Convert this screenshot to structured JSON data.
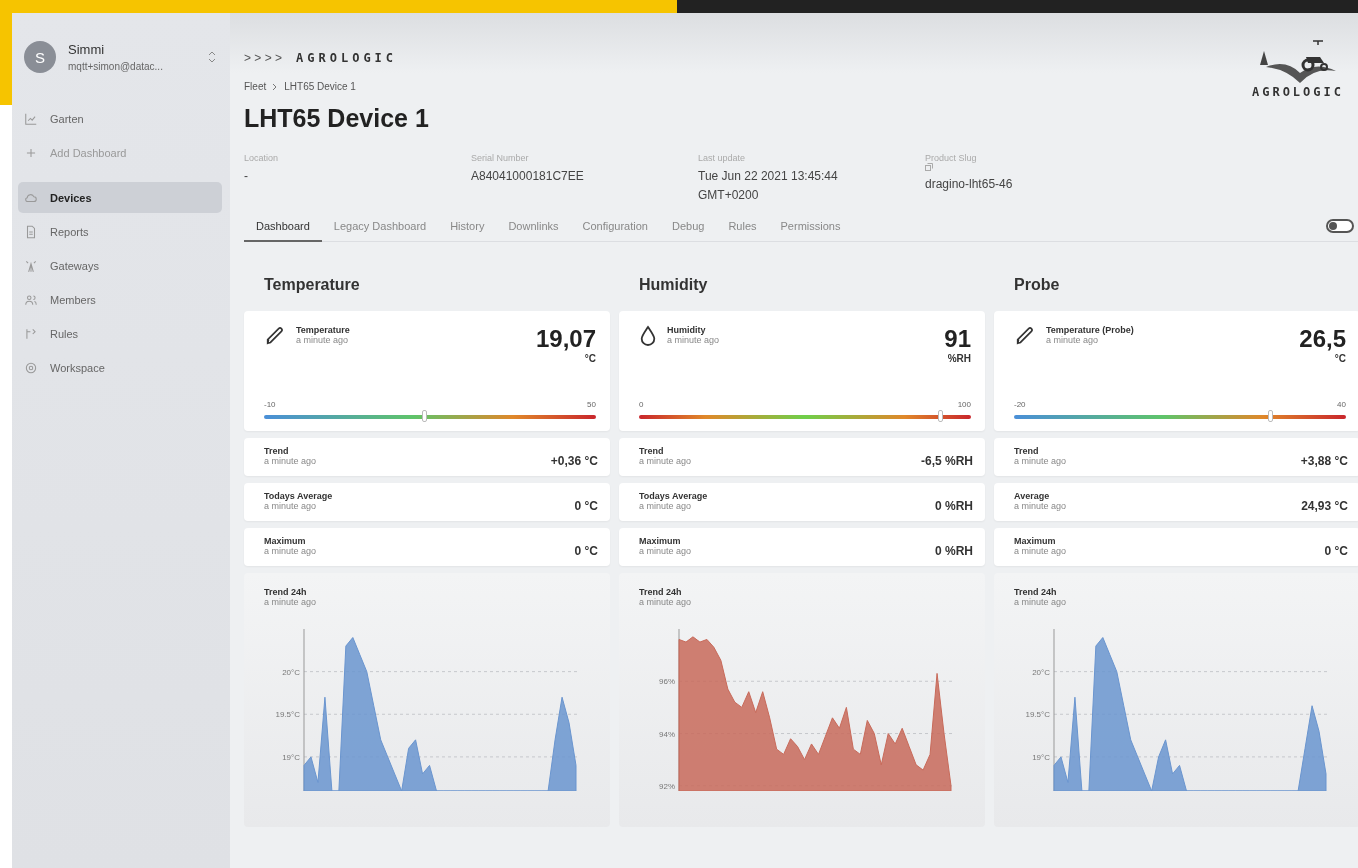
{
  "user": {
    "initial": "S",
    "name": "Simmi",
    "email": "mqtt+simon@datac..."
  },
  "sidebar": {
    "items": [
      {
        "label": "Garten",
        "kind": "dashboard",
        "selected": false
      },
      {
        "label": "Add Dashboard",
        "kind": "action",
        "selected": false
      },
      {
        "label": "Devices",
        "kind": "nav",
        "selected": true
      },
      {
        "label": "Reports",
        "kind": "nav",
        "selected": false
      },
      {
        "label": "Gateways",
        "kind": "nav",
        "selected": false
      },
      {
        "label": "Members",
        "kind": "nav",
        "selected": false
      },
      {
        "label": "Rules",
        "kind": "nav",
        "selected": false
      },
      {
        "label": "Workspace",
        "kind": "nav",
        "selected": false
      }
    ]
  },
  "brand": {
    "chevrons": "> >  > >",
    "name": "AGROLOGIC",
    "logo_text": "AGROLOGIC"
  },
  "breadcrumb": [
    "Fleet",
    "LHT65 Device 1"
  ],
  "title": "LHT65 Device 1",
  "details": [
    {
      "label": "Location",
      "value": "-"
    },
    {
      "label": "Serial Number",
      "value": "A84041000181C7EE"
    },
    {
      "label": "Last update",
      "value": "Tue Jun 22 2021 13:45:44 GMT+0200"
    },
    {
      "label": "Product Slug",
      "value": "dragino-lht65-46"
    }
  ],
  "tabs": [
    {
      "label": "Dashboard",
      "selected": true
    },
    {
      "label": "Legacy Dashboard",
      "selected": false
    },
    {
      "label": "History",
      "selected": false
    },
    {
      "label": "Downlinks",
      "selected": false
    },
    {
      "label": "Configuration",
      "selected": false
    },
    {
      "label": "Debug",
      "selected": false
    },
    {
      "label": "Rules",
      "selected": false
    },
    {
      "label": "Permissions",
      "selected": false
    }
  ],
  "toggle": {
    "on": false
  },
  "columns": [
    {
      "heading": "Temperature",
      "gauge": {
        "kind": "temperature",
        "name": "Temperature",
        "time": "a minute ago",
        "value": "19,07",
        "unit": "°C",
        "min": "-10",
        "max": "50",
        "level": 0.485
      },
      "stats": [
        {
          "name": "Trend",
          "time": "a minute ago",
          "value": "+0,36 °C"
        },
        {
          "name": "Todays Average",
          "time": "a minute ago",
          "value": "0 °C"
        },
        {
          "name": "Maximum",
          "time": "a minute ago",
          "value": "0 °C"
        }
      ],
      "trend": {
        "name": "Trend 24h",
        "time": "a minute ago",
        "chart_data": {
          "type": "area",
          "grid": true,
          "ylim": [
            18.6,
            20.5
          ],
          "yticks": [
            {
              "value": 19,
              "label": "19°C"
            },
            {
              "value": 19.5,
              "label": "19.5°C"
            },
            {
              "value": 20,
              "label": "20°C"
            }
          ],
          "series": [
            {
              "color": "#6a95cf",
              "values": [
                18.9,
                19.0,
                18.7,
                19.7,
                null,
                null,
                20.3,
                20.4,
                20.2,
                20.0,
                19.6,
                19.2,
                19.0,
                18.8,
                null,
                19.1,
                19.2,
                18.8,
                18.9,
                null,
                null,
                null,
                null,
                null,
                null,
                null,
                null,
                null,
                null,
                null,
                null,
                null,
                null,
                null,
                null,
                null,
                19.2,
                19.7,
                19.4,
                18.9
              ]
            }
          ]
        }
      }
    },
    {
      "heading": "Humidity",
      "gauge": {
        "kind": "humidity",
        "name": "Humidity",
        "time": "a minute ago",
        "value": "91",
        "unit": "%RH",
        "min": "0",
        "max": "100",
        "level": 0.91
      },
      "stats": [
        {
          "name": "Trend",
          "time": "a minute ago",
          "value": "-6,5 %RH"
        },
        {
          "name": "Todays Average",
          "time": "a minute ago",
          "value": "0 %RH"
        },
        {
          "name": "Maximum",
          "time": "a minute ago",
          "value": "0 %RH"
        }
      ],
      "trend": {
        "name": "Trend 24h",
        "time": "a minute ago",
        "chart_data": {
          "type": "area",
          "grid": true,
          "ylim": [
            91.8,
            98
          ],
          "yticks": [
            {
              "value": 92,
              "label": "92%"
            },
            {
              "value": 94,
              "label": "94%"
            },
            {
              "value": 96,
              "label": "96%"
            }
          ],
          "series": [
            {
              "color": "#c86a5a",
              "values": [
                97.6,
                97.5,
                97.7,
                97.5,
                97.6,
                97.3,
                96.8,
                95.7,
                95.2,
                95.0,
                95.6,
                94.8,
                95.6,
                94.6,
                93.4,
                93.2,
                93.8,
                93.5,
                93.0,
                93.6,
                93.2,
                93.9,
                94.6,
                94.2,
                95.0,
                93.4,
                93.2,
                94.5,
                94.0,
                92.8,
                94.0,
                93.6,
                94.2,
                93.5,
                92.8,
                92.6,
                93.2,
                96.3,
                94.0,
                92.0
              ]
            }
          ]
        }
      }
    },
    {
      "heading": "Probe",
      "gauge": {
        "kind": "temperature",
        "name": "Temperature (Probe)",
        "time": "a minute ago",
        "value": "26,5",
        "unit": "°C",
        "min": "-20",
        "max": "40",
        "level": 0.775
      },
      "stats": [
        {
          "name": "Trend",
          "time": "a minute ago",
          "value": "+3,88 °C"
        },
        {
          "name": "Average",
          "time": "a minute ago",
          "value": "24,93 °C"
        },
        {
          "name": "Maximum",
          "time": "a minute ago",
          "value": "0 °C"
        }
      ],
      "trend": {
        "name": "Trend 24h",
        "time": "a minute ago",
        "chart_data": {
          "type": "area",
          "grid": true,
          "ylim": [
            18.6,
            20.5
          ],
          "yticks": [
            {
              "value": 19,
              "label": "19°C"
            },
            {
              "value": 19.5,
              "label": "19.5°C"
            },
            {
              "value": 20,
              "label": "20°C"
            }
          ],
          "series": [
            {
              "color": "#6a95cf",
              "values": [
                18.9,
                19.0,
                18.7,
                19.7,
                null,
                null,
                20.3,
                20.4,
                20.2,
                20.0,
                19.6,
                19.2,
                19.0,
                18.8,
                null,
                19.0,
                19.2,
                18.8,
                18.9,
                null,
                null,
                null,
                null,
                null,
                null,
                null,
                null,
                null,
                null,
                null,
                null,
                null,
                null,
                null,
                null,
                null,
                19.1,
                19.6,
                19.3,
                18.8
              ]
            }
          ]
        }
      }
    }
  ]
}
